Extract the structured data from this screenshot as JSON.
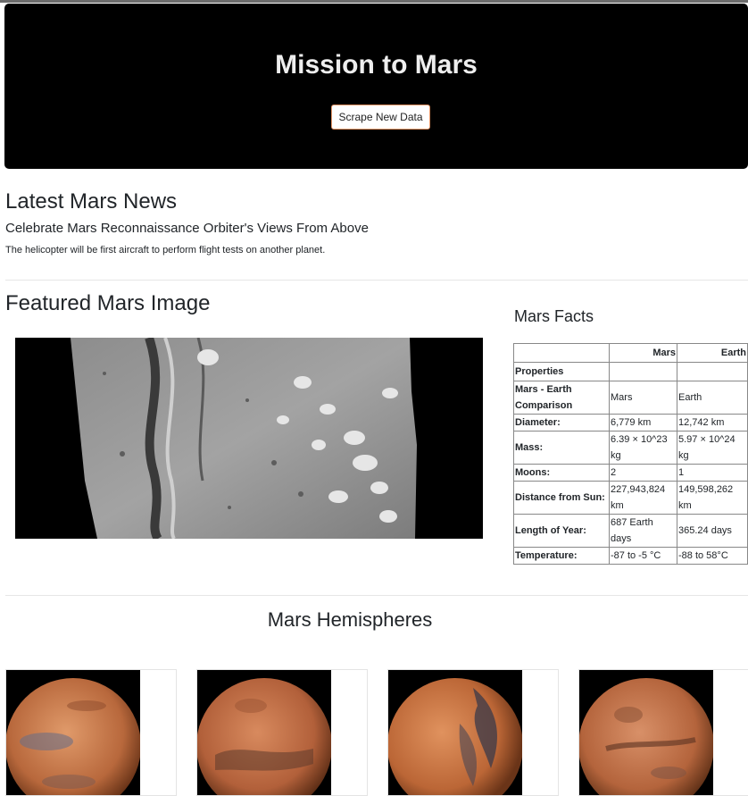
{
  "header": {
    "title": "Mission to Mars",
    "scrape_button": "Scrape New Data"
  },
  "news": {
    "section_title": "Latest Mars News",
    "headline": "Celebrate Mars Reconnaissance Orbiter's Views From Above",
    "teaser": "The helicopter will be first aircraft to perform flight tests on another planet."
  },
  "featured": {
    "section_title": "Featured Mars Image"
  },
  "facts": {
    "section_title": "Mars Facts",
    "columns": [
      "",
      "Mars",
      "Earth"
    ],
    "index_label": "Properties",
    "rows": [
      {
        "label": "Mars - Earth Comparison",
        "mars": "Mars",
        "earth": "Earth"
      },
      {
        "label": "Diameter:",
        "mars": "6,779 km",
        "earth": "12,742 km"
      },
      {
        "label": "Mass:",
        "mars": "6.39 × 10^23 kg",
        "earth": "5.97 × 10^24 kg"
      },
      {
        "label": "Moons:",
        "mars": "2",
        "earth": "1"
      },
      {
        "label": "Distance from Sun:",
        "mars": "227,943,824 km",
        "earth": "149,598,262 km"
      },
      {
        "label": "Length of Year:",
        "mars": "687 Earth days",
        "earth": "365.24 days"
      },
      {
        "label": "Temperature:",
        "mars": "-87 to -5 °C",
        "earth": "-88 to 58°C"
      }
    ]
  },
  "hemispheres": {
    "section_title": "Mars Hemispheres",
    "items": [
      {
        "icon": "cerberus-hemisphere-image"
      },
      {
        "icon": "schiaparelli-hemisphere-image"
      },
      {
        "icon": "syrtis-major-hemisphere-image"
      },
      {
        "icon": "valles-marineris-hemisphere-image"
      }
    ]
  },
  "colors": {
    "jumbotron_bg": "#000000",
    "button_border": "#e59566",
    "mars_surface": "#c26a3c"
  }
}
